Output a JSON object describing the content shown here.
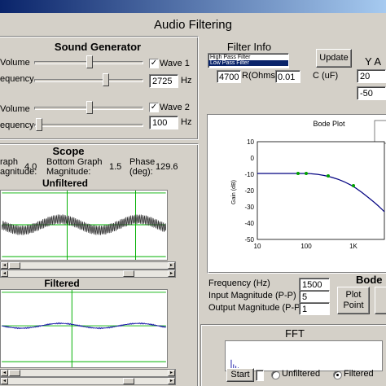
{
  "window": {
    "title": "Audio Filtering"
  },
  "sound_generator": {
    "title": "Sound Generator",
    "wave1": {
      "volume_label": "Volume",
      "frequency_label": "equency",
      "checkbox_label": "Wave 1",
      "checked": true,
      "frequency_value": "2725",
      "unit": "Hz",
      "volume_level": 0.5,
      "frequency_level": 0.62
    },
    "wave2": {
      "volume_label": "Volume",
      "frequency_label": "equency",
      "checkbox_label": "Wave 2",
      "checked": true,
      "frequency_value": "100",
      "unit": "Hz",
      "volume_level": 0.5,
      "frequency_level": 0.04
    }
  },
  "scope": {
    "title": "Scope",
    "top_graph_label": "raph",
    "top_magnitude_label": "agnitude:",
    "top_magnitude_value": "4.0",
    "bottom_graph_label": "Bottom Graph",
    "bottom_magnitude_label": "Magnitude:",
    "bottom_magnitude_value": "1.5",
    "phase_label": "Phase",
    "phase_unit": "(deg):",
    "phase_value": "129.6",
    "unfiltered_title": "Unfiltered",
    "filtered_title": "Filtered",
    "colors": {
      "grid": "#00b000",
      "unfiltered_wave": "#303030",
      "filtered_wave": "#1a1aa8"
    }
  },
  "filter_info": {
    "title": "Filter Info",
    "options": [
      "High Pass Filter",
      "Low Pass Filter"
    ],
    "selected": "Low Pass Filter",
    "r_value": "4700",
    "r_label": "R(Ohms)",
    "c_value": "0.01",
    "c_label": "C (uF)",
    "update_button": "Update"
  },
  "y_axis": {
    "label": "Y A",
    "max_value": "20",
    "min_value": "-50"
  },
  "bode_plot": {
    "title": "Bode Plot",
    "ylabel": "Gain (dB)",
    "yticks": [
      "10",
      "0",
      "-10",
      "-20",
      "-30",
      "-40",
      "-50"
    ],
    "xticks": [
      "10",
      "100",
      "1K"
    ],
    "colors": {
      "curve": "#000080",
      "points": "#00a000"
    }
  },
  "bode_controls": {
    "title": "Bode I",
    "frequency_label": "Frequency (Hz)",
    "frequency_value": "1500",
    "input_label": "Input Magnitude (P-P)",
    "input_value": "5",
    "output_label": "Output Magnitude (P-P)",
    "output_value": "1",
    "plot_button_line1": "Plot",
    "plot_button_line2": "Point"
  },
  "fft": {
    "title": "FFT",
    "start_button": "Start",
    "unfiltered_label": "Unfiltered",
    "filtered_label": "Filtered",
    "selected": "Filtered"
  }
}
